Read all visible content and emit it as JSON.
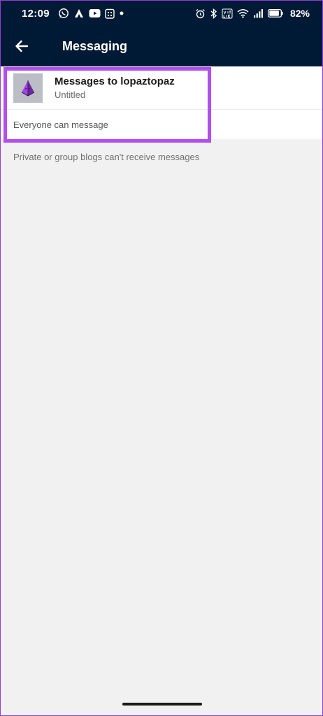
{
  "status_bar": {
    "time": "12:09",
    "battery_percent": "82%",
    "left_icons": [
      "whatsapp-icon",
      "app-icon",
      "youtube-icon",
      "calendar-icon",
      "dot-icon"
    ],
    "right_icons": [
      "alarm-icon",
      "bluetooth-icon",
      "volte-icon",
      "wifi-icon",
      "signal-icon",
      "battery-icon"
    ]
  },
  "app_bar": {
    "title": "Messaging",
    "back_icon": "back-arrow-icon"
  },
  "blog_card": {
    "title": "Messages to lopaztopaz",
    "subtitle": "Untitled",
    "setting": "Everyone can message",
    "avatar_icon": "pyramid-avatar-icon"
  },
  "note": "Private or group blogs can't receive messages",
  "colors": {
    "header_bg": "#001935",
    "highlight": "#b24df0",
    "page_bg": "#f1f1f1"
  }
}
